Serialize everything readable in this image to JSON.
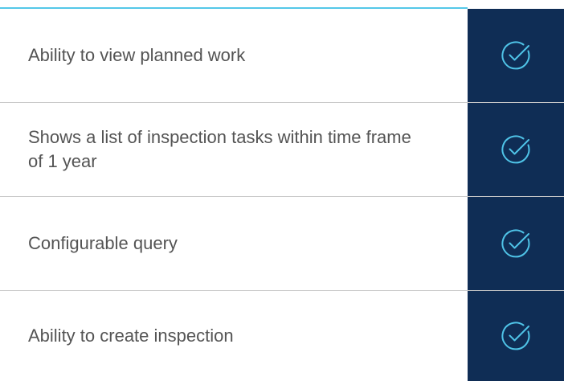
{
  "features": [
    {
      "label": "Ability to view planned work",
      "icon": "check-circle-icon"
    },
    {
      "label": "Shows a list of inspection tasks within time frame of 1 year",
      "icon": "check-circle-icon"
    },
    {
      "label": "Configurable query",
      "icon": "check-circle-icon"
    },
    {
      "label": "Ability to create inspection",
      "icon": "check-circle-icon"
    }
  ],
  "colors": {
    "accent_rule": "#54c8e8",
    "panel": "#0f2d55",
    "check": "#4fc3e7",
    "text": "#545454",
    "divider": "#c9c9c9"
  }
}
